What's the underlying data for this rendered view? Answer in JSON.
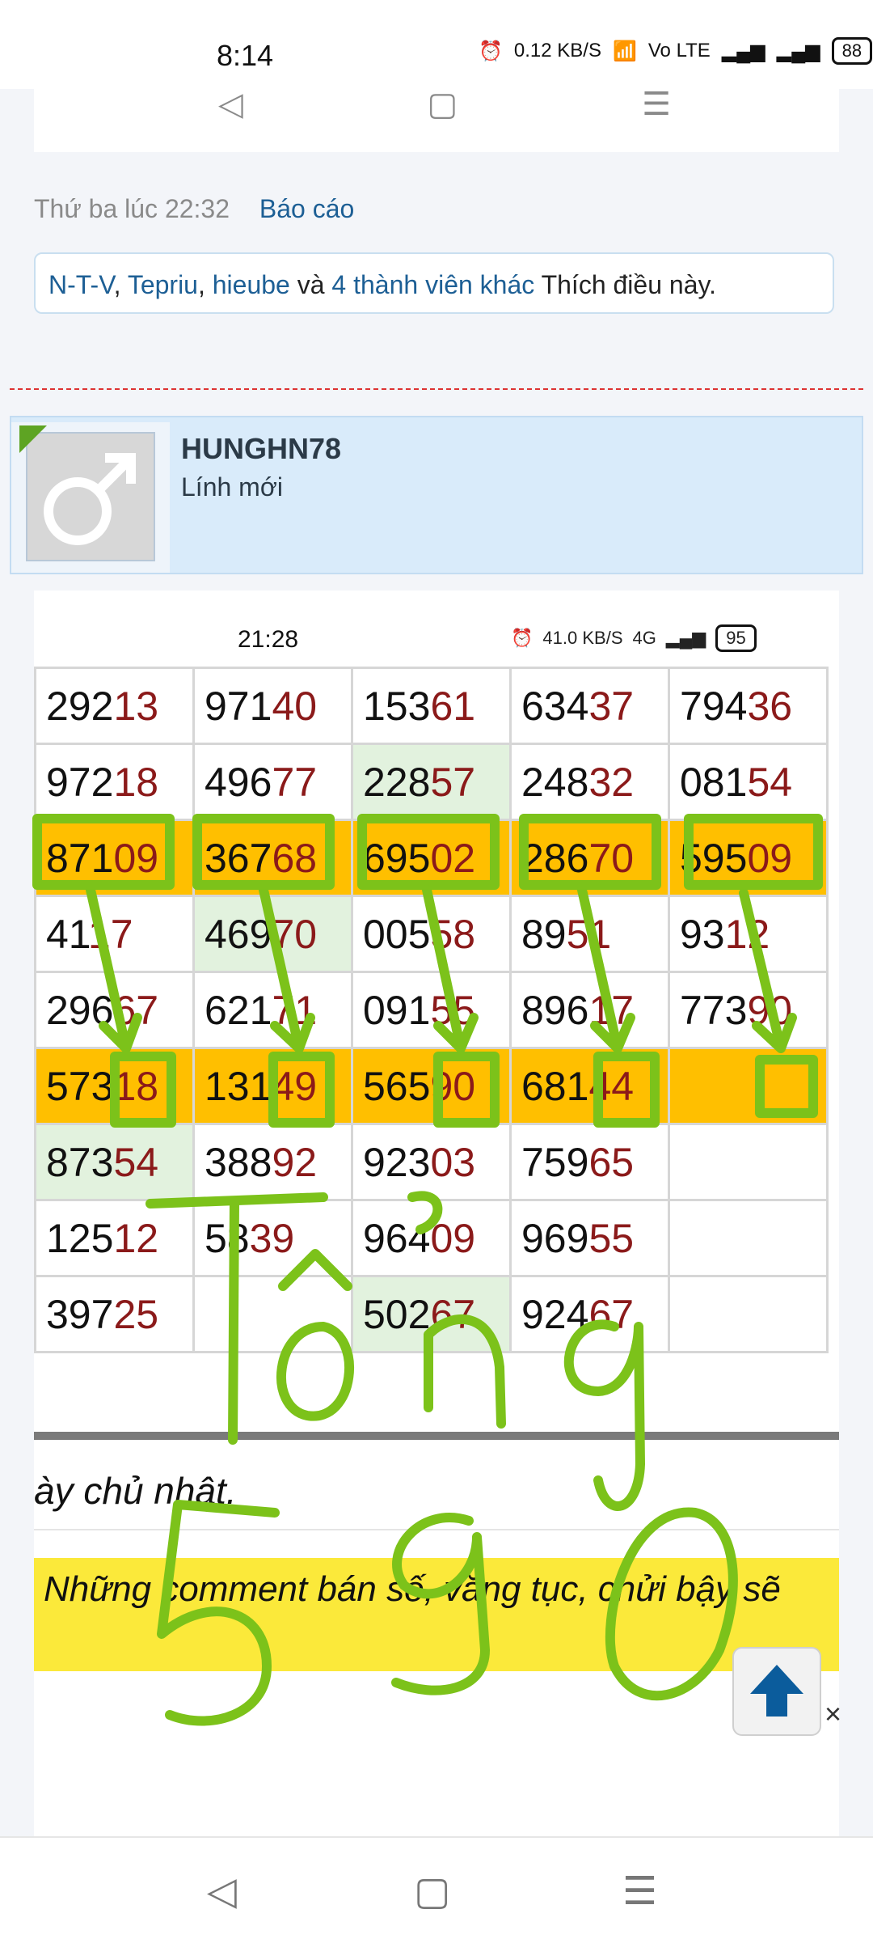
{
  "status_bar": {
    "time": "8:14",
    "speed": "0.12",
    "speed_unit": "KB/S",
    "volte": "Vo LTE",
    "battery": "88"
  },
  "post_meta": {
    "timestamp": "Thứ ba lúc 22:32",
    "report_link": "Báo cáo"
  },
  "likes": {
    "user1": "N-T-V",
    "user2": "Tepriu",
    "user3": "hieube",
    "and_text": "và",
    "others_link": "4 thành viên khác",
    "suffix": "Thích điều này."
  },
  "user": {
    "name": "HUNGHN78",
    "rank": "Lính mới"
  },
  "inner_screenshot": {
    "time": "21:28",
    "speed": "41.0",
    "speed_unit": "KB/S",
    "network": "4G",
    "battery": "95",
    "rows": [
      [
        {
          "a": "292",
          "b": "13"
        },
        {
          "a": "971",
          "b": "40"
        },
        {
          "a": "153",
          "b": "61"
        },
        {
          "a": "634",
          "b": "37"
        },
        {
          "a": "794",
          "b": "36"
        }
      ],
      [
        {
          "a": "972",
          "b": "18"
        },
        {
          "a": "496",
          "b": "77"
        },
        {
          "a": "228",
          "b": "57"
        },
        {
          "a": "248",
          "b": "32"
        },
        {
          "a": "081",
          "b": "54"
        }
      ],
      [
        {
          "a": "871",
          "b": "09"
        },
        {
          "a": "367",
          "b": "68"
        },
        {
          "a": "695",
          "b": "02"
        },
        {
          "a": "286",
          "b": "70"
        },
        {
          "a": "595",
          "b": "09"
        }
      ],
      [
        {
          "a": "41",
          "b": "17"
        },
        {
          "a": "469",
          "b": "70"
        },
        {
          "a": "005",
          "b": "58"
        },
        {
          "a": "89",
          "b": "51"
        },
        {
          "a": "93",
          "b": "12"
        }
      ],
      [
        {
          "a": "296",
          "b": "67"
        },
        {
          "a": "621",
          "b": "71"
        },
        {
          "a": "091",
          "b": "55"
        },
        {
          "a": "896",
          "b": "17"
        },
        {
          "a": "773",
          "b": "90"
        }
      ],
      [
        {
          "a": "573",
          "b": "18"
        },
        {
          "a": "131",
          "b": "49"
        },
        {
          "a": "565",
          "b": "90"
        },
        {
          "a": "681",
          "b": "44"
        },
        {
          "a": "",
          "b": ""
        }
      ],
      [
        {
          "a": "873",
          "b": "54"
        },
        {
          "a": "388",
          "b": "92"
        },
        {
          "a": "923",
          "b": "03"
        },
        {
          "a": "759",
          "b": "65"
        },
        {
          "a": "",
          "b": ""
        }
      ],
      [
        {
          "a": "125",
          "b": "12"
        },
        {
          "a": "58",
          "b": "39"
        },
        {
          "a": "964",
          "b": "09"
        },
        {
          "a": "969",
          "b": "55"
        },
        {
          "a": "",
          "b": ""
        }
      ],
      [
        {
          "a": "397",
          "b": "25"
        },
        {
          "a": "",
          "b": ""
        },
        {
          "a": "502",
          "b": "67"
        },
        {
          "a": "924",
          "b": "67"
        },
        {
          "a": "",
          "b": ""
        }
      ]
    ],
    "footer_text": "ày chủ nhật.",
    "notice_text": "Những comment bán số, văng tục, chửi bậy sẽ"
  },
  "handwriting": {
    "line1": "Tổng",
    "line2": "5 9 0"
  },
  "colors": {
    "highlight": "#ffbf00",
    "green_cell": "#e2f2de",
    "annotation": "#7cc21a",
    "link": "#1d5f95",
    "notice": "#fbe93a"
  },
  "icons": {
    "scroll_top": "arrow-up-icon",
    "close": "close-icon"
  }
}
